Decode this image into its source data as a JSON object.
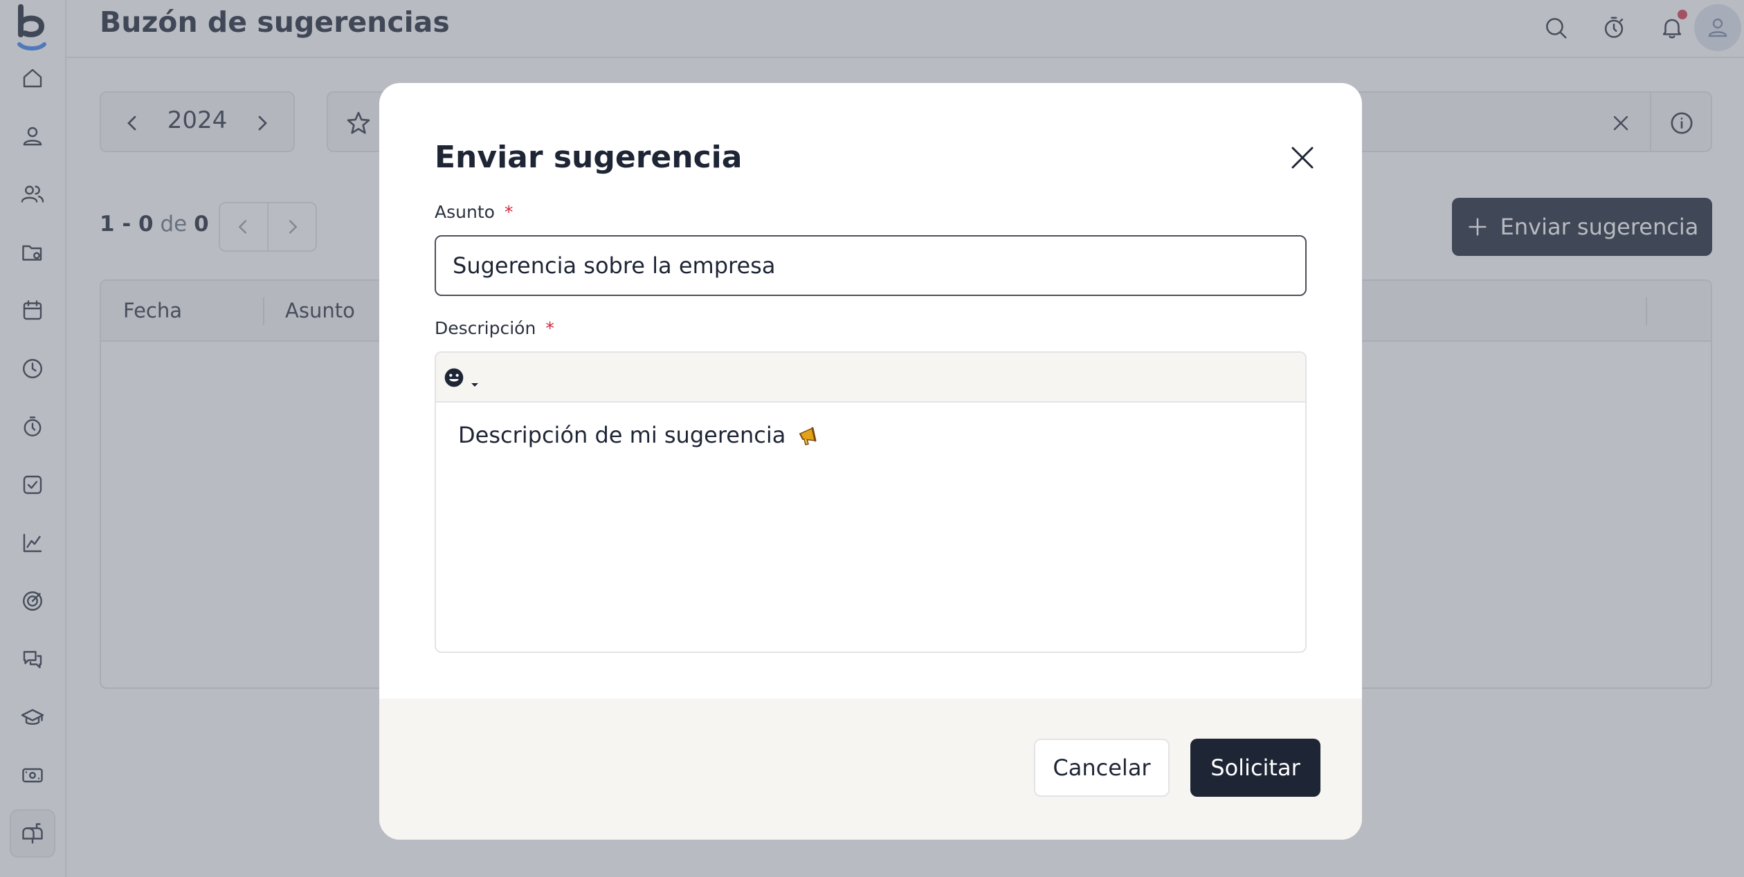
{
  "page": {
    "title": "Buzón de sugerencias"
  },
  "sidebar": {
    "items": [
      {
        "icon": "home-icon"
      },
      {
        "icon": "user-icon"
      },
      {
        "icon": "users-icon"
      },
      {
        "icon": "folder-icon"
      },
      {
        "icon": "calendar-icon"
      },
      {
        "icon": "clock-icon"
      },
      {
        "icon": "stopwatch-icon"
      },
      {
        "icon": "checkbox-icon"
      },
      {
        "icon": "chart-line-icon"
      },
      {
        "icon": "target-icon"
      },
      {
        "icon": "chat-icon"
      },
      {
        "icon": "graduation-cap-icon"
      },
      {
        "icon": "money-icon"
      },
      {
        "icon": "mailbox-icon",
        "active": true
      }
    ]
  },
  "topbar": {
    "icons": [
      "search-icon",
      "stopwatch-icon",
      "bell-icon",
      "avatar"
    ],
    "notification_dot_color": "#d93a4f"
  },
  "filters": {
    "year": "2024"
  },
  "pagination": {
    "range": "1 - 0",
    "connector": "de",
    "total": "0"
  },
  "actions": {
    "send_suggestion": "Enviar sugerencia"
  },
  "table": {
    "columns": [
      "Fecha",
      "Asunto"
    ]
  },
  "modal": {
    "title": "Enviar sugerencia",
    "subject": {
      "label": "Asunto",
      "required_mark": "*",
      "value": "Sugerencia sobre la empresa"
    },
    "description": {
      "label": "Descripción",
      "required_mark": "*",
      "text": "Descripción de mi sugerencia",
      "emoji": "megaphone"
    },
    "cancel_label": "Cancelar",
    "submit_label": "Solicitar"
  },
  "colors": {
    "primary": "#1e2535",
    "required": "#d0283c",
    "logo_accent": "#3b82f6",
    "overlay": "rgba(105,110,124,0.47)",
    "footer_bg": "#f6f5f1"
  }
}
